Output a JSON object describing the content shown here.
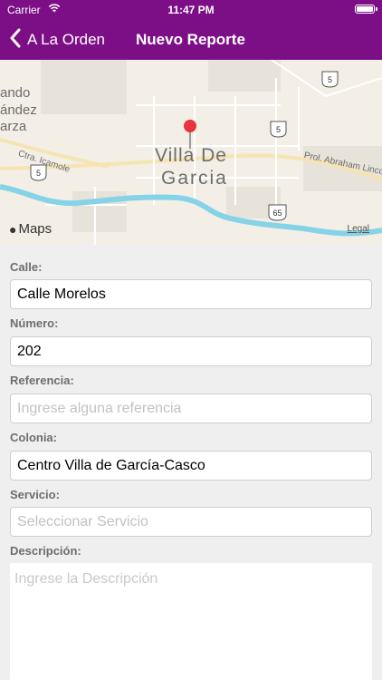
{
  "status_bar": {
    "carrier": "Carrier",
    "time": "11:47 PM",
    "icons": [
      "wifi-icon",
      "battery-icon"
    ]
  },
  "nav": {
    "back_label": "A La Orden",
    "title": "Nuevo Reporte",
    "color": "#7d0f86"
  },
  "map": {
    "city_label_line1": "Villa De",
    "city_label_line2": "Garcia",
    "street1": "Ctra. Icamole",
    "street2": "Prol. Abraham Linco",
    "place_line1": "ando",
    "place_line2": "ández",
    "place_line3": "arza",
    "route_shields": [
      "5",
      "5",
      "5",
      "65"
    ],
    "attribution": "Maps",
    "legal": "Legal",
    "pin_color": "#e8323c"
  },
  "form": {
    "calle": {
      "label": "Calle:",
      "value": "Calle Morelos"
    },
    "numero": {
      "label": "Número:",
      "value": "202"
    },
    "referencia": {
      "label": "Referencia:",
      "placeholder": "Ingrese alguna referencia"
    },
    "colonia": {
      "label": "Colonia:",
      "value": "Centro Villa de García-Casco"
    },
    "servicio": {
      "label": "Servicio:",
      "placeholder": "Seleccionar Servicio"
    },
    "descripcion": {
      "label": "Descripción:",
      "placeholder": "Ingrese la Descripción"
    }
  }
}
